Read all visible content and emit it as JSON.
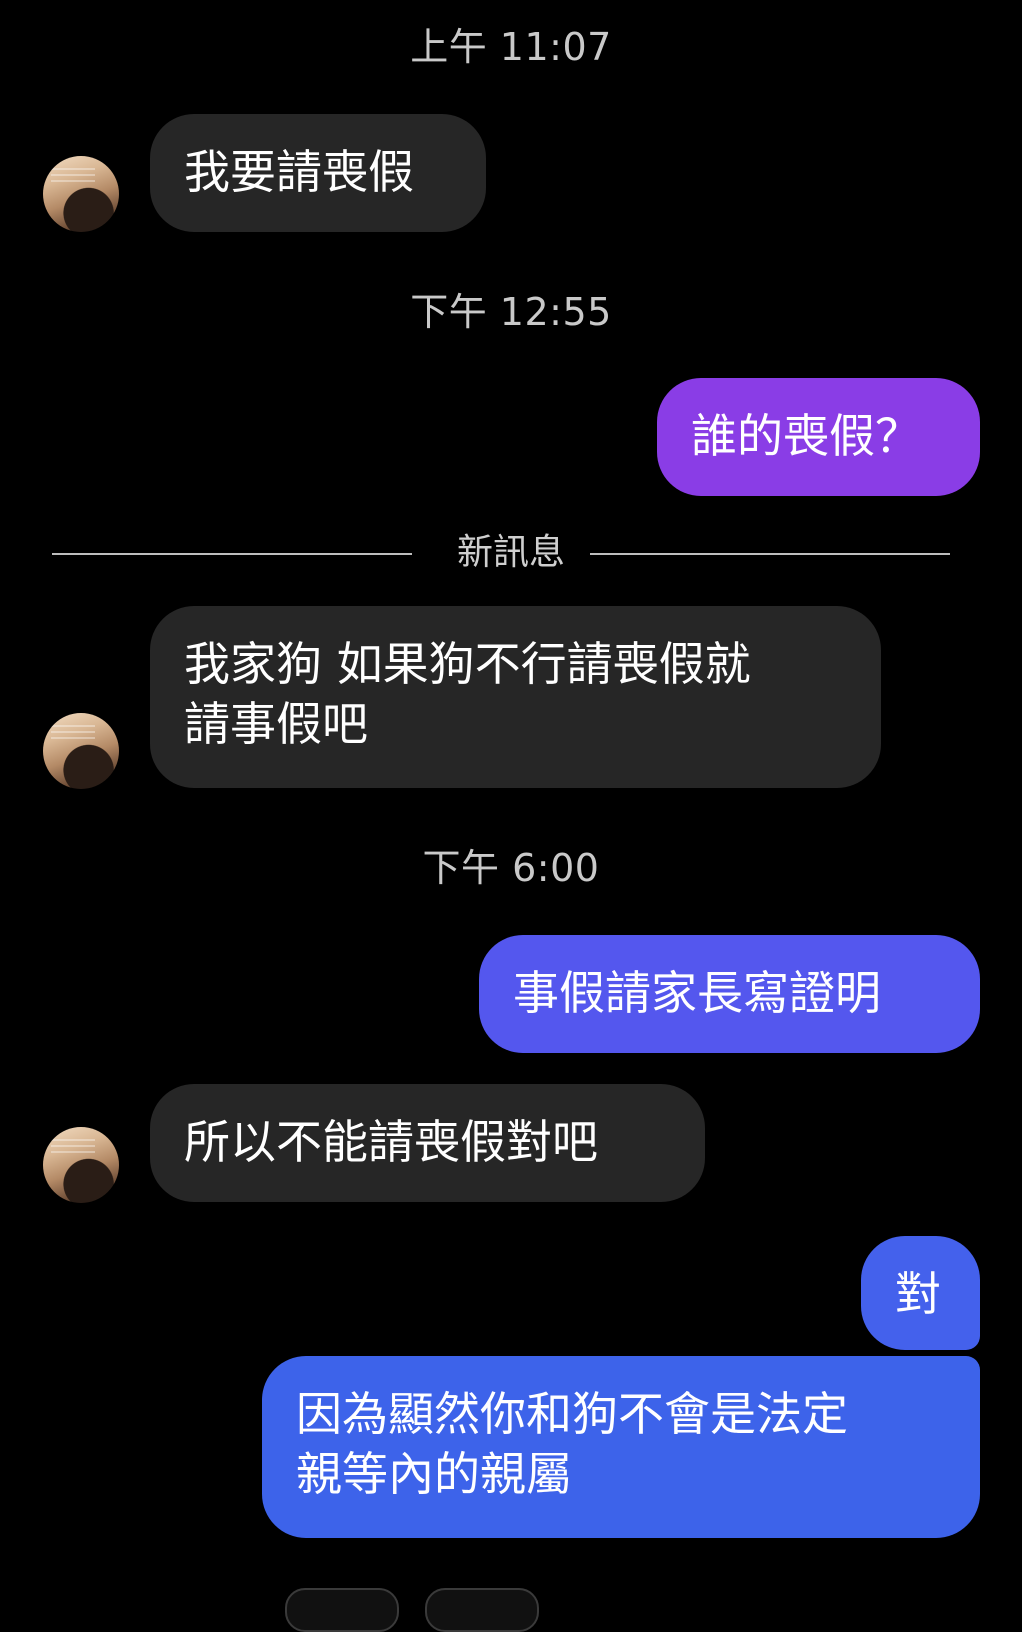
{
  "colors": {
    "background": "#000000",
    "incoming_bubble": "#262626",
    "outgoing_purple": "#8A3DE6",
    "outgoing_indigo": "#5457EE",
    "outgoing_blue": "#3D63EA",
    "timestamp_text": "#c9c9c9"
  },
  "conversation": {
    "timestamps": [
      "上午 11:07",
      "下午 12:55",
      "下午 6:00"
    ],
    "new_messages_divider": "新訊息",
    "messages": [
      {
        "direction": "incoming",
        "text": "我要請喪假"
      },
      {
        "direction": "outgoing",
        "text": "誰的喪假？"
      },
      {
        "direction": "incoming",
        "text": "我家狗 如果狗不行請喪假就\n請事假吧"
      },
      {
        "direction": "outgoing",
        "text": "事假請家長寫證明"
      },
      {
        "direction": "incoming",
        "text": "所以不能請喪假對吧"
      },
      {
        "direction": "outgoing",
        "text": "對"
      },
      {
        "direction": "outgoing",
        "text": "因為顯然你和狗不會是法定\n親等內的親屬"
      }
    ]
  },
  "avatar_icon": "user-avatar-photo"
}
